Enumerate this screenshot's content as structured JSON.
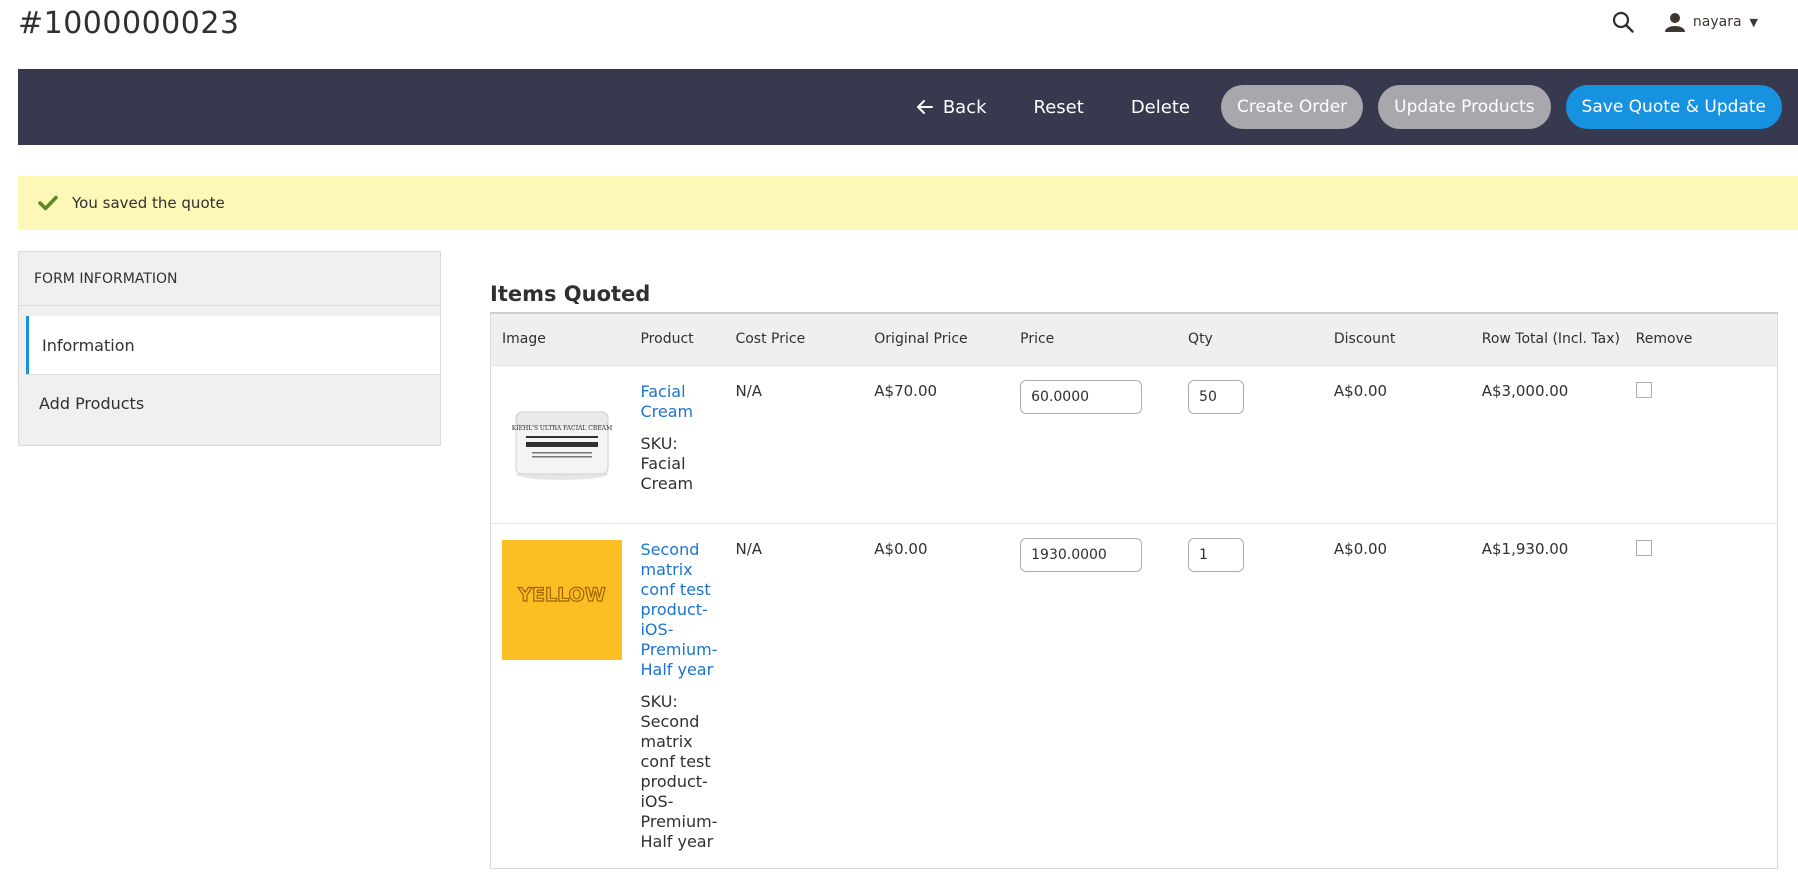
{
  "header": {
    "title": "#1000000023",
    "user": "nayara",
    "icons": {
      "search": "search-icon",
      "user": "user-icon",
      "caret": "caret-down-icon"
    }
  },
  "actions": {
    "back": "Back",
    "reset": "Reset",
    "delete": "Delete",
    "create_order": "Create Order",
    "update_products": "Update Products",
    "save_quote": "Save Quote & Update"
  },
  "notice": {
    "message": "You saved the quote",
    "icon": "checkmark-icon",
    "color": "#5b8a2a"
  },
  "sidebar": {
    "title": "FORM INFORMATION",
    "tabs": [
      {
        "label": "Information",
        "active": true
      },
      {
        "label": "Add Products",
        "active": false
      }
    ]
  },
  "items": {
    "title": "Items Quoted",
    "columns": [
      "Image",
      "Product",
      "Cost Price",
      "Original Price",
      "Price",
      "Qty",
      "Discount",
      "Row Total (Incl. Tax)",
      "Remove"
    ],
    "rows": [
      {
        "image_label": "KIEHL'S ULTRA FACIAL CREAM",
        "product": "Facial Cream",
        "sku_line": "SKU: Facial Cream",
        "cost_price": "N/A",
        "original_price": "A$70.00",
        "price": "60.0000",
        "qty": "50",
        "discount": "A$0.00",
        "row_total": "A$3,000.00"
      },
      {
        "image_label": "YELLOW",
        "product": "Second matrix conf test product-iOS-Premium-Half year",
        "sku_line": "SKU: Second matrix conf test product-iOS-Premium-Half year",
        "cost_price": "N/A",
        "original_price": "A$0.00",
        "price": "1930.0000",
        "qty": "1",
        "discount": "A$0.00",
        "row_total": "A$1,930.00"
      }
    ]
  },
  "colors": {
    "action_bar": "#373a4e",
    "primary": "#1792e1",
    "disabled": "#a7a7ac",
    "notice_bg": "#fdf8b8",
    "link": "#1a74cf"
  }
}
